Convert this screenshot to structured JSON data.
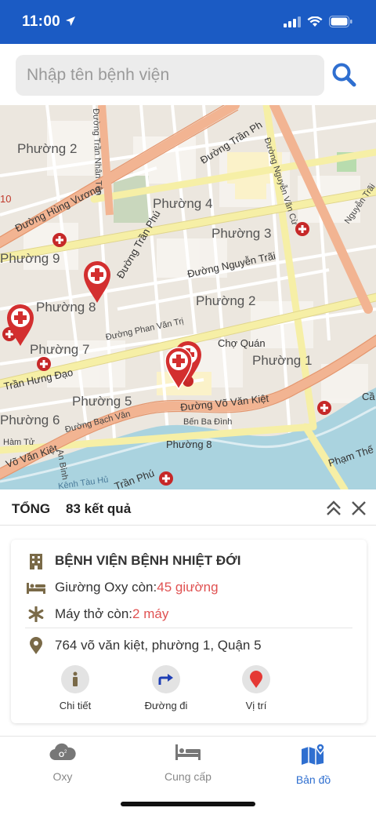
{
  "status": {
    "time": "11:00"
  },
  "search": {
    "placeholder": "Nhập tên bệnh viện"
  },
  "map": {
    "labels": {
      "p2a": "Phường 2",
      "p4": "Phường 4",
      "p3": "Phường 3",
      "p9": "Phường 9",
      "p8a": "Phường 8",
      "p2b": "Phường 2",
      "p7": "Phường 7",
      "p1": "Phường 1",
      "p5": "Phường 5",
      "p6": "Phường 6",
      "p8b": "Phường 8",
      "cho_quan": "Chợ Quán",
      "vo_van_kiet": "Đường Võ Văn Kiệt",
      "vo_van_kiet2": "Võ Văn Kiệt",
      "nguyen_trai": "Đường Nguyễn Trãi",
      "tran_hung_dao": "Trần Hưng Đạo",
      "hung_vuong": "Đường Hùng Vương",
      "tran_phu": "Đường Trần Phú",
      "tran_phu2": "Trần Phú",
      "phan_van_tri": "Đường Phan Văn Trị",
      "bach_van": "Đường Bạch Vân",
      "ben_ba_dinh": "Bến Ba Đình",
      "nguyen_van_cu": "Đường Nguyễn Văn Cừ",
      "tran_nhan_ton": "Đường Trần Nhân Tôn",
      "pham_the": "Phạm Thế",
      "duong_tran": "Đường Trần Ph",
      "nguyen_trai_right": "Nguyễn Trãi",
      "ham_tu": "Hàm Tử",
      "an_binh": "An Bình",
      "kenh_tau_hu": "Kênh Tàu Hủ",
      "cau": "Cầ",
      "p10": "10"
    }
  },
  "summary": {
    "label": "TỔNG",
    "count": "83 kết quả"
  },
  "hospital": {
    "name": "BỆNH VIỆN BỆNH NHIỆT ĐỚI",
    "oxy_label": "Giường Oxy còn: ",
    "oxy_value": "45 giường",
    "vent_label": "Máy thở còn: ",
    "vent_value": "2 máy",
    "address": "764 võ văn kiệt, phường 1, Quận 5"
  },
  "actions": {
    "detail": "Chi tiết",
    "directions": "Đường đi",
    "location": "Vị trí"
  },
  "tabs": {
    "oxy": "Oxy",
    "supply": "Cung cấp",
    "map": "Bản đồ"
  },
  "colors": {
    "primary": "#1b5bc4",
    "accent": "#2f6fd0",
    "alert": "#e05252",
    "marker": "#d32f2f"
  }
}
